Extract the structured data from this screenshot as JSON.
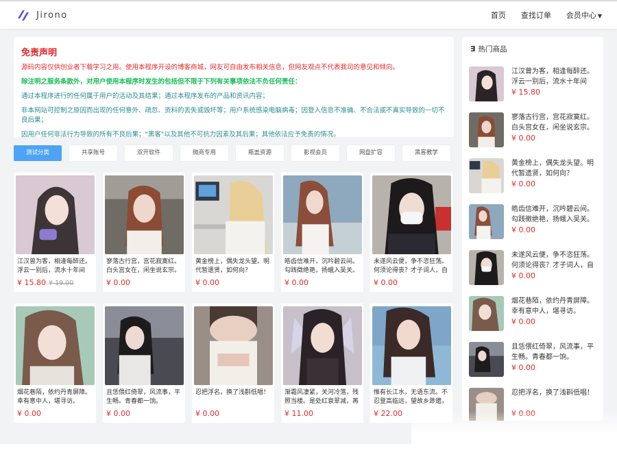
{
  "brand": {
    "name": "Jirono",
    "accent": "#5b4fe0"
  },
  "nav": {
    "home": "首页",
    "orders": "查找订单",
    "member": "会员中心"
  },
  "disclaimer": {
    "title": "免责声明",
    "line1": "源码内容仅供创业者下载学习之用。使用本程序开设的博客商城，网友可自由发布相关信息，但网友观点不代表我司的意见和倾向。",
    "line2": "除注明之服务条款外，对用户使用本程序时发生的包括但不限于下列有关事项依法不负任何责任：",
    "line3": "通过本程序进行的任何属于用户的活动及其结果；通过本程序发布的产品和资讯内容；",
    "line4": "非本网站可控制之原因而出现的任何意外、疏忽、资料的丢失或毁坏等；用户系统感染电脑病毒；因登入信息不准确、不合法或不真实导致的一切不良后果；",
    "line5": "因用户任何非法行为导致的所有不良后果；\"黑客\"以及其他不可抗力因素及其后果；其他依法应予免责的情况。",
    "colors": {
      "red": "#e02a2a",
      "green": "#1bbd5a",
      "teal": "#2a8a92"
    }
  },
  "tabs": [
    "测试分类",
    "共享账号",
    "双开软件",
    "微商专用",
    "瓶盖资源",
    "影视会员",
    "网盘扩容",
    "黑客教学"
  ],
  "products": [
    {
      "title": "江汉曾为客，相逢每醉还。浮云一别后，流水十年间",
      "price": "¥ 15.80",
      "old_price": "¥ 19.00"
    },
    {
      "title": "寥落古行宫，宫花寂寞红。白头宫女在，闲坐说玄宗。",
      "price": "¥ 0.00"
    },
    {
      "title": "黄金榜上，偶失龙头望。明代暂遗贤，如何向？",
      "price": "¥ 0.00"
    },
    {
      "title": "皓齿信难开，沉吟碧云间。勾践徵绝艳，扬蛾入吴关。",
      "price": "¥ 0.00"
    },
    {
      "title": "未遂风云便，争不恣狂荡。何须论得丧？才子词人，自是白衣卿相。",
      "price": "¥ 0.00"
    },
    {
      "title": "烟花巷陌，依约丹青屏障。幸有意中人，堪寻访。",
      "price": "¥ 0.00"
    },
    {
      "title": "且恁偎红倚翠，风流事，平生畅。青春都一饷。",
      "price": "¥ 0.00"
    },
    {
      "title": "忍把浮名，换了浅斟低唱！",
      "price": "¥ 0.00"
    },
    {
      "title": "渐霜风凄紧，关河冷落，残照当楼。是处红衰翠减，苒苒物华休。",
      "price": "¥ 11.00"
    },
    {
      "title": "惟有长江水，无语东流。不忍登高临远，望故乡渺邈，归思难收。",
      "price": "¥ 22.00"
    }
  ],
  "sidebar": {
    "title": "热门商品",
    "items": [
      {
        "title": "江汉曾为客，相逢每醉还。浮云一别后，流水十年间",
        "price": "¥ 15.80"
      },
      {
        "title": "寥落古行宫，宫花寂寞红。白头宫女在，闲坐说玄宗。",
        "price": "¥ 0.00"
      },
      {
        "title": "黄金榜上，偶失龙头望。明代暂遗贤，如何向？",
        "price": "¥ 0.00"
      },
      {
        "title": "皓齿信难开，沉吟碧云间。勾践徵绝艳，扬蛾入吴关。",
        "price": "¥ 0.00"
      },
      {
        "title": "未遂风云便，争不恣狂荡。何须论得丧？才子词人，自是白衣卿相。",
        "price": "¥ 0.00"
      },
      {
        "title": "烟花巷陌，依约丹青屏障。幸有意中人，堪寻访。",
        "price": "¥ 0.00"
      },
      {
        "title": "且恁偎红倚翠，风流事，平生畅。青春都一饷。",
        "price": "¥ 0.00"
      },
      {
        "title": "忍把浮名，换了浅斟低唱！",
        "price": "¥ 0.00"
      }
    ]
  }
}
